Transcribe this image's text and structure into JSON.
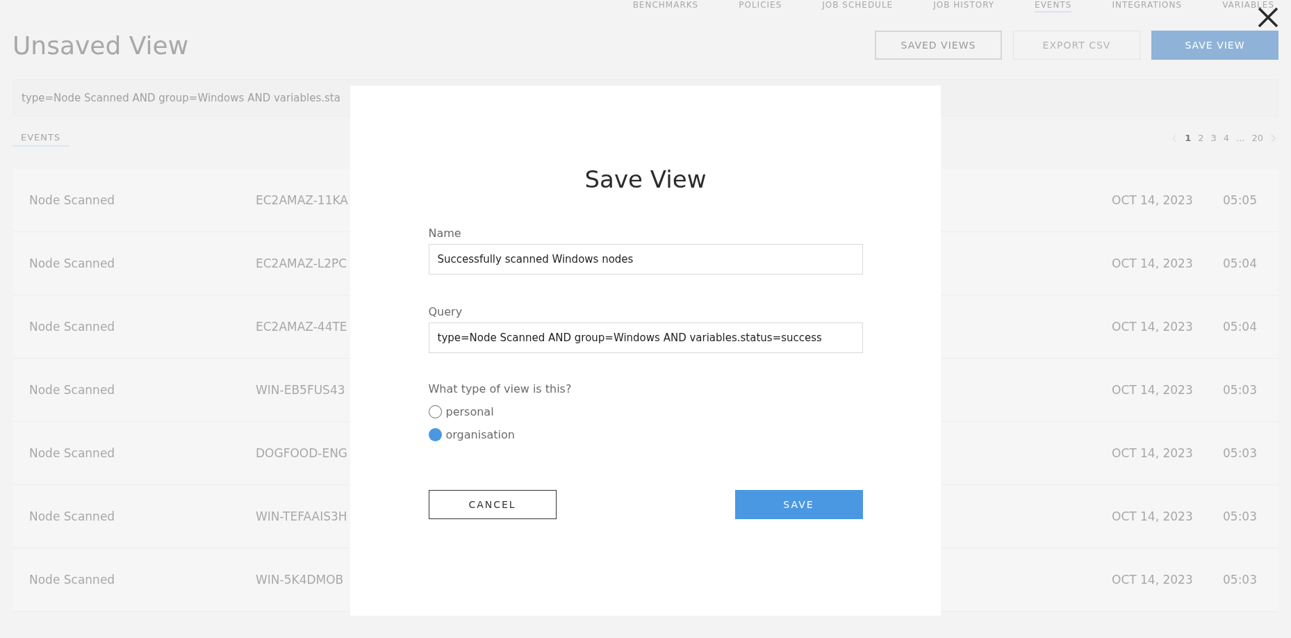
{
  "nav_tabs": [
    {
      "label": "BENCHMARKS",
      "selected": false
    },
    {
      "label": "POLICIES",
      "selected": false
    },
    {
      "label": "JOB SCHEDULE",
      "selected": false
    },
    {
      "label": "JOB HISTORY",
      "selected": false
    },
    {
      "label": "EVENTS",
      "selected": true
    },
    {
      "label": "INTEGRATIONS",
      "selected": false
    },
    {
      "label": "VARIABLES",
      "selected": false
    }
  ],
  "page_title": "Unsaved View",
  "header_buttons": [
    {
      "label": "SAVED VIEWS",
      "kind": "outline"
    },
    {
      "label": "EXPORT CSV",
      "kind": "disabled"
    },
    {
      "label": "SAVE VIEW",
      "kind": "primary"
    }
  ],
  "query_bar": {
    "value": "type=Node Scanned AND group=Windows AND variables.sta"
  },
  "section_tab": {
    "label": "EVENTS",
    "selected": true
  },
  "pagination": {
    "pages": [
      {
        "label": "1",
        "selected": true
      },
      {
        "label": "2",
        "selected": false
      },
      {
        "label": "3",
        "selected": false
      },
      {
        "label": "4",
        "selected": false
      },
      {
        "label": "...",
        "selected": false
      },
      {
        "label": "20",
        "selected": false
      }
    ]
  },
  "table": {
    "rows": [
      {
        "type": "Node Scanned",
        "host": "EC2AMAZ-11KA",
        "date": "OCT 14, 2023",
        "time": "05:05"
      },
      {
        "type": "Node Scanned",
        "host": "EC2AMAZ-L2PC",
        "date": "OCT 14, 2023",
        "time": "05:04"
      },
      {
        "type": "Node Scanned",
        "host": "EC2AMAZ-44TE",
        "date": "OCT 14, 2023",
        "time": "05:04"
      },
      {
        "type": "Node Scanned",
        "host": "WIN-EB5FUS43",
        "date": "OCT 14, 2023",
        "time": "05:03"
      },
      {
        "type": "Node Scanned",
        "host": "DOGFOOD-ENG",
        "date": "OCT 14, 2023",
        "time": "05:03"
      },
      {
        "type": "Node Scanned",
        "host": "WIN-TEFAAIS3H",
        "date": "OCT 14, 2023",
        "time": "05:03"
      },
      {
        "type": "Node Scanned",
        "host": "WIN-5K4DMOB",
        "date": "OCT 14, 2023",
        "time": "05:03"
      }
    ]
  },
  "modal": {
    "title": "Save View",
    "name": {
      "label": "Name",
      "value": "Successfully scanned Windows nodes"
    },
    "query": {
      "label": "Query",
      "value": "type=Node Scanned AND group=Windows AND variables.status=success"
    },
    "view_type": {
      "question": "What type of view is this?",
      "options": [
        {
          "label": "personal",
          "selected": false
        },
        {
          "label": "organisation",
          "selected": true
        }
      ]
    },
    "cancel": "CANCEL",
    "save": "SAVE"
  }
}
